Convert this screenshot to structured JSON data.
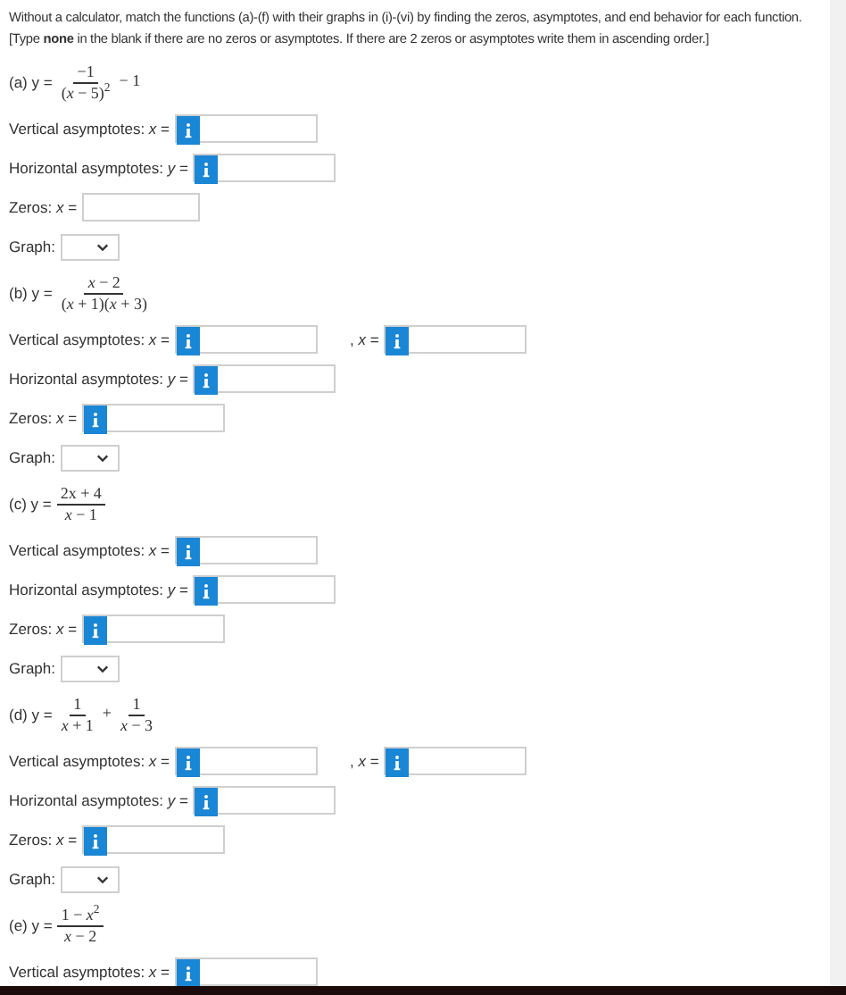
{
  "instructions": "Without a calculator, match the functions (a)-(f) with their graphs in (i)-(vi) by finding the zeros, asymptotes, and end behavior for each function. [Type **none** in the blank if there are no zeros or asymptotes. If there are 2 zeros or asymptotes write them in ascending order.]",
  "problems": [
    {
      "label": "(a) y =",
      "formula": [
        {
          "kind": "fraction",
          "numerator": "−1",
          "denominator": "(*x* − 5)$^{2}$"
        },
        {
          "kind": "text",
          "text": "− 1"
        }
      ],
      "rows": [
        {
          "label": "Vertical asymptotes: *x* =",
          "fields": [
            {
              "kind": "info"
            }
          ]
        },
        {
          "label": "Horizontal asymptotes: *y* =",
          "fields": [
            {
              "kind": "info"
            }
          ]
        },
        {
          "label": "Zeros: *x* =",
          "fields": [
            {
              "kind": "plain"
            }
          ]
        }
      ],
      "graph_label": "Graph:"
    },
    {
      "label": "(b) y =",
      "formula": [
        {
          "kind": "fraction",
          "numerator": "*x* − 2",
          "denominator": "(*x* + 1)(*x* + 3)"
        }
      ],
      "rows": [
        {
          "label": "Vertical asymptotes: *x* =",
          "fields": [
            {
              "kind": "info"
            },
            {
              "kind": "info",
              "prefix": ", *x* ="
            }
          ]
        },
        {
          "label": "Horizontal asymptotes: *y* =",
          "fields": [
            {
              "kind": "info"
            }
          ]
        },
        {
          "label": "Zeros: *x* =",
          "fields": [
            {
              "kind": "info"
            }
          ]
        }
      ],
      "graph_label": "Graph:"
    },
    {
      "label": "(c) y =",
      "formula": [
        {
          "kind": "fraction",
          "numerator": "2x + 4",
          "denominator": "*x* − 1"
        }
      ],
      "rows": [
        {
          "label": "Vertical asymptotes: *x* =",
          "fields": [
            {
              "kind": "info"
            }
          ]
        },
        {
          "label": "Horizontal asymptotes: *y* =",
          "fields": [
            {
              "kind": "info"
            }
          ]
        },
        {
          "label": "Zeros: *x* =",
          "fields": [
            {
              "kind": "info"
            }
          ]
        }
      ],
      "graph_label": "Graph:"
    },
    {
      "label": "(d) y =",
      "formula": [
        {
          "kind": "fraction",
          "numerator": "1",
          "denominator": "*x* + 1"
        },
        {
          "kind": "text",
          "text": "+"
        },
        {
          "kind": "fraction",
          "numerator": "1",
          "denominator": "*x* − 3"
        }
      ],
      "rows": [
        {
          "label": "Vertical asymptotes: *x* =",
          "fields": [
            {
              "kind": "info"
            },
            {
              "kind": "info",
              "prefix": ", *x* ="
            }
          ]
        },
        {
          "label": "Horizontal asymptotes: *y* =",
          "fields": [
            {
              "kind": "info"
            }
          ]
        },
        {
          "label": "Zeros: *x* =",
          "fields": [
            {
              "kind": "info"
            }
          ]
        }
      ],
      "graph_label": "Graph:"
    },
    {
      "label": "(e) y =",
      "formula": [
        {
          "kind": "fraction",
          "numerator": "1 − *x*$^{2}$",
          "denominator": "*x* − 2"
        }
      ],
      "rows": [
        {
          "label": "Vertical asymptotes: *x* =",
          "fields": [
            {
              "kind": "info"
            }
          ]
        }
      ]
    }
  ]
}
